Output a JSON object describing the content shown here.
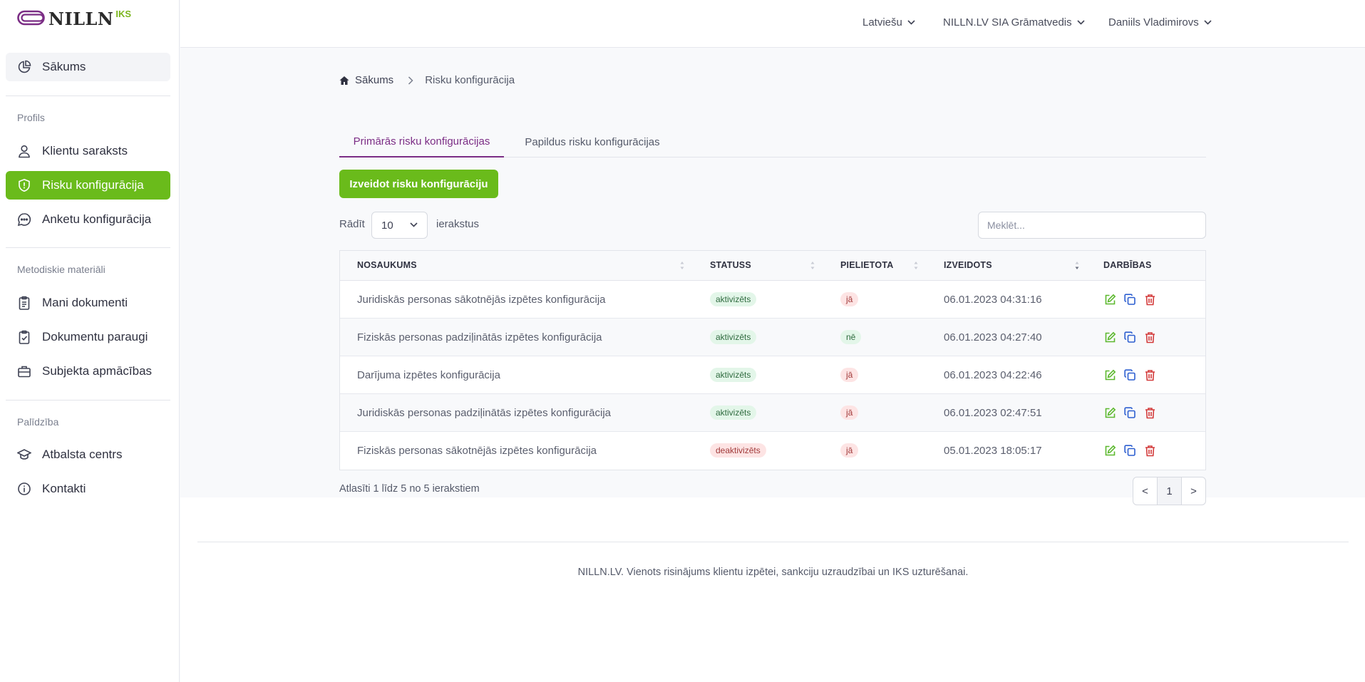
{
  "brand": {
    "name": "NILLN",
    "sup": "IKS"
  },
  "sidebar": {
    "home": {
      "label": "Sākums",
      "icon": "pie-chart-icon"
    },
    "sections": [
      {
        "label": "Profils",
        "items": [
          {
            "label": "Klientu saraksts",
            "icon": "user-icon"
          },
          {
            "label": "Risku konfigurācija",
            "icon": "shield-icon",
            "active": true
          },
          {
            "label": "Anketu konfigurācija",
            "icon": "chat-icon"
          }
        ]
      },
      {
        "label": "Metodiskie materiāli",
        "items": [
          {
            "label": "Mani dokumenti",
            "icon": "clipboard-list-icon"
          },
          {
            "label": "Dokumentu paraugi",
            "icon": "clipboard-check-icon"
          },
          {
            "label": "Subjekta apmācības",
            "icon": "briefcase-icon"
          }
        ]
      },
      {
        "label": "Palīdzība",
        "items": [
          {
            "label": "Atbalsta centrs",
            "icon": "graduation-cap-icon"
          },
          {
            "label": "Kontakti",
            "icon": "info-icon"
          }
        ]
      }
    ]
  },
  "topbar": {
    "language": "Latviešu",
    "company": "NILLN.LV SIA Grāmatvedis",
    "user": "Daniils Vladimirovs"
  },
  "breadcrumb": {
    "home": "Sākums",
    "current": "Risku konfigurācija"
  },
  "tabs": [
    {
      "label": "Primārās risku konfigurācijas",
      "active": true
    },
    {
      "label": "Papildus risku konfigurācijas",
      "active": false
    }
  ],
  "create_button": "Izveidot risku konfigurāciju",
  "length_control": {
    "show": "Rādīt",
    "value": "10",
    "entries": "ierakstus"
  },
  "search": {
    "placeholder": "Meklēt..."
  },
  "table": {
    "headers": [
      "NOSAUKUMS",
      "STATUSS",
      "PIELIETOTA",
      "IZVEIDOTS",
      "DARBĪBAS"
    ],
    "rows": [
      {
        "name": "Juridiskās personas sākotnējās izpētes konfigurācija",
        "status": "aktivizēts",
        "status_kind": "green",
        "applied": "jā",
        "applied_kind": "red",
        "created": "06.01.2023 04:31:16"
      },
      {
        "name": "Fiziskās personas padziļinātās izpētes konfigurācija",
        "status": "aktivizēts",
        "status_kind": "green",
        "applied": "nē",
        "applied_kind": "green",
        "created": "06.01.2023 04:27:40"
      },
      {
        "name": "Darījuma izpētes konfigurācija",
        "status": "aktivizēts",
        "status_kind": "green",
        "applied": "jā",
        "applied_kind": "red",
        "created": "06.01.2023 04:22:46"
      },
      {
        "name": "Juridiskās personas padziļinātās izpētes konfigurācija",
        "status": "aktivizēts",
        "status_kind": "green",
        "applied": "jā",
        "applied_kind": "red",
        "created": "06.01.2023 02:47:51"
      },
      {
        "name": "Fiziskās personas sākotnējās izpētes konfigurācija",
        "status": "deaktivizēts",
        "status_kind": "red",
        "applied": "jā",
        "applied_kind": "red",
        "created": "05.01.2023 18:05:17"
      }
    ]
  },
  "info": "Atlasīti 1 līdz 5 no 5 ierakstiem",
  "pager": {
    "prev": "<",
    "page": "1",
    "next": ">"
  },
  "footer": "NILLN.LV. Vienots risinājums klientu izpētei, sankciju uzraudzībai un IKS uzturēšanai.",
  "colors": {
    "accent": "#6abb1b",
    "brand_purple": "#7b2d85",
    "edit": "#5cb82e",
    "copy": "#2d5fd0",
    "delete": "#d33a3a"
  }
}
